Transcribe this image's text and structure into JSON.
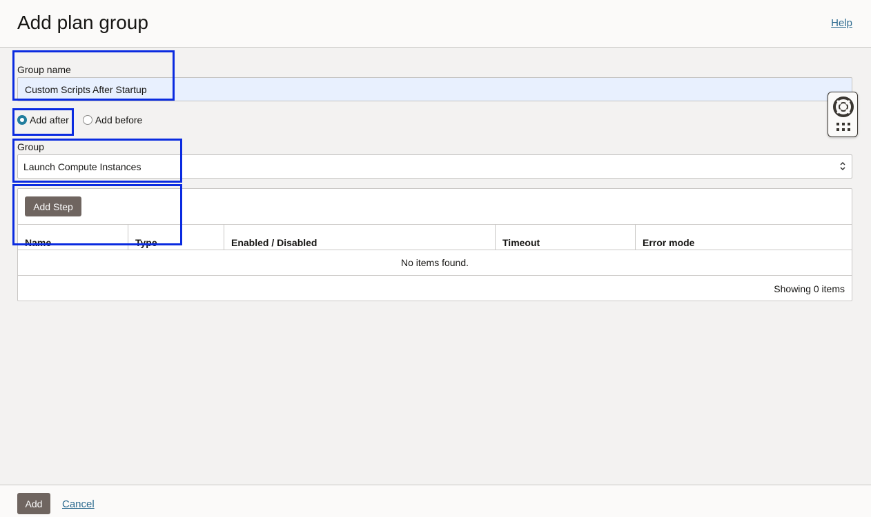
{
  "header": {
    "title": "Add plan group",
    "help_label": "Help"
  },
  "form": {
    "group_name_label": "Group name",
    "group_name_value": "Custom Scripts After Startup",
    "position_options": [
      {
        "label": "Add after",
        "checked": true
      },
      {
        "label": "Add before",
        "checked": false
      }
    ],
    "group_label": "Group",
    "group_selected": "Launch Compute Instances"
  },
  "steps_table": {
    "add_step_label": "Add Step",
    "columns": [
      "Name",
      "Type",
      "Enabled / Disabled",
      "Timeout",
      "Error mode"
    ],
    "empty_message": "No items found.",
    "count_text": "Showing 0 items"
  },
  "footer": {
    "add_label": "Add",
    "cancel_label": "Cancel"
  },
  "icons": {
    "help_widget": [
      "lifebuoy-icon",
      "apps-grid-icon"
    ],
    "select_caret": "chevron-updown-icon"
  },
  "colors": {
    "accent_radio": "#227e9e",
    "button_dark": "#6f6560",
    "link": "#2c6a8f",
    "highlight_box": "#0a2be0",
    "autofill_bg": "#e8f0fe"
  }
}
